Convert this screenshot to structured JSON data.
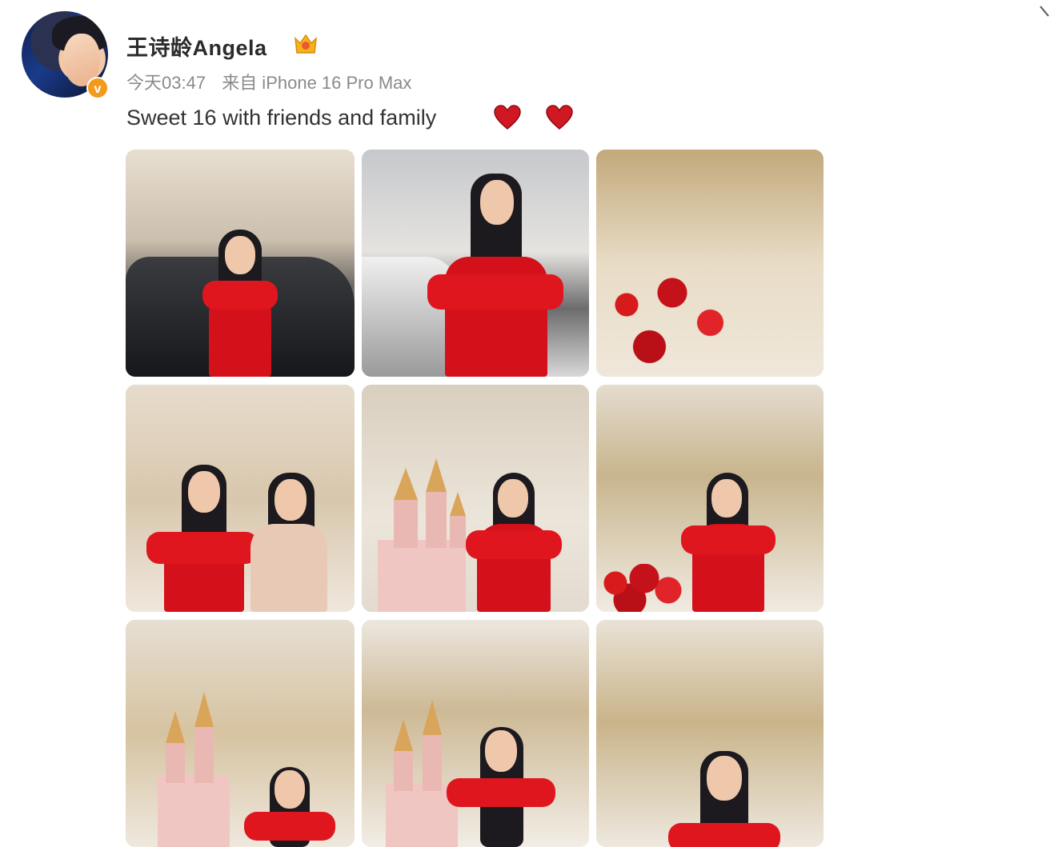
{
  "post": {
    "username": "王诗龄Angela",
    "time": "今天03:47",
    "source": "来自 iPhone 16 Pro Max",
    "text": "Sweet 16 with friends and family",
    "verified_badge_color": "#f39a1b",
    "heart_color": "#d01822",
    "photos": [
      {
        "name": "photo-car-entrance"
      },
      {
        "name": "photo-car-closeup"
      },
      {
        "name": "photo-dining-table"
      },
      {
        "name": "photo-with-guest"
      },
      {
        "name": "photo-castle-cake"
      },
      {
        "name": "photo-ballroom"
      },
      {
        "name": "photo-castle-cake-2"
      },
      {
        "name": "photo-castle-cake-3"
      },
      {
        "name": "photo-ballroom-2"
      }
    ]
  }
}
